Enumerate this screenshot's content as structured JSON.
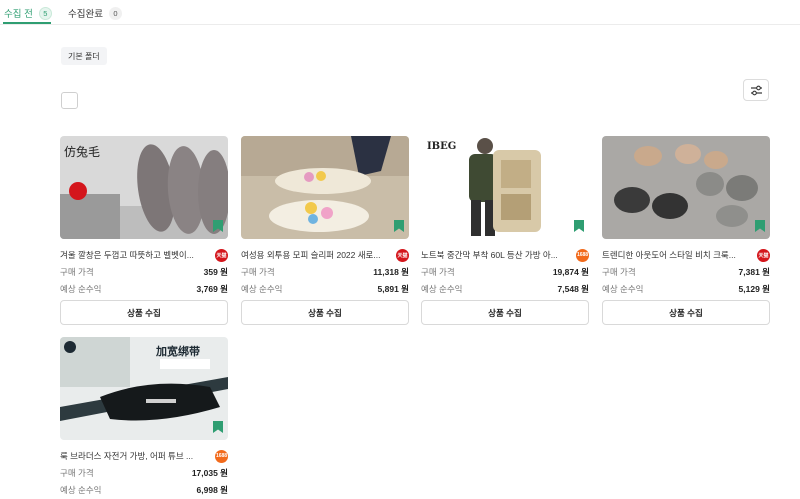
{
  "tabs": [
    {
      "label": "수집 전",
      "count": "5"
    },
    {
      "label": "수집완료",
      "count": "0"
    }
  ],
  "folder": {
    "label": "기본 폴더"
  },
  "labels": {
    "price": "구매 가격",
    "profit": "예상 순수익",
    "collect_button": "상품 수집"
  },
  "products": [
    {
      "title": "겨울 깔창은 두껍고 따뜻하고 벨벳이...",
      "store": "tmall",
      "price": "359 원",
      "profit": "3,769 원",
      "image_text": "仿兔毛"
    },
    {
      "title": "여성용 외투용 모피 슬리퍼 2022 새로...",
      "store": "tmall",
      "price": "11,318 원",
      "profit": "5,891 원",
      "image_text": ""
    },
    {
      "title": "노트북 중간막 부착 60L 등산 가방 아...",
      "store": "1688",
      "price": "19,874 원",
      "profit": "7,548 원",
      "image_text": "IBEG"
    },
    {
      "title": "트렌디한 아웃도어 스타일 비치 크룩...",
      "store": "tmall",
      "price": "7,381 원",
      "profit": "5,129 원",
      "image_text": ""
    },
    {
      "title": "룩 브라더스 자전거 가방, 어퍼 튜브 ...",
      "store": "1688",
      "price": "17,035 원",
      "profit": "6,998 원",
      "image_text": "加宽绑带"
    }
  ],
  "icons": {
    "bookmark_color": "#2f9e72",
    "accent": "#2f9e72"
  }
}
